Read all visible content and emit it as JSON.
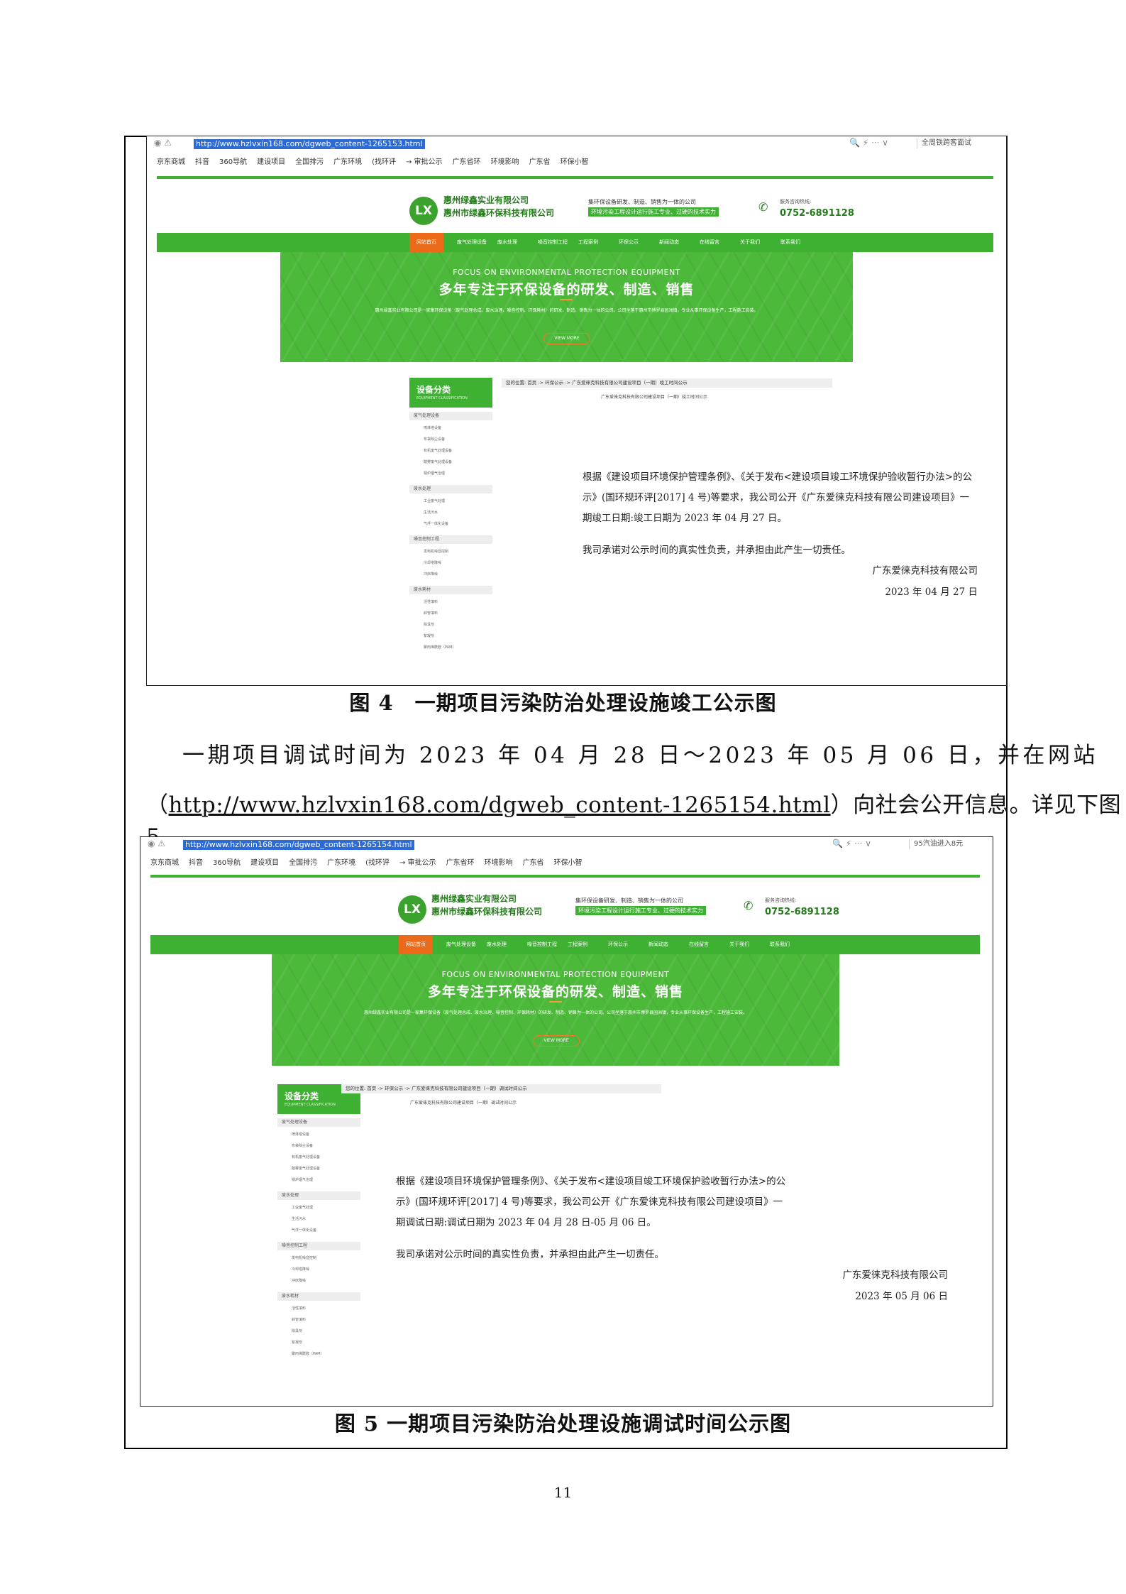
{
  "page_number": "11",
  "figure4": {
    "caption": "图 4　一期项目污染防治处理设施竣工公示图",
    "screenshot": {
      "url": "http://www.hzlvxin168.com/dgweb_content-1265153.html",
      "search_text": "全周铁跨客面试",
      "bookmarks": [
        "京东商城",
        "抖音",
        "360导航",
        "建设项目",
        "全国排污",
        "广东环境",
        "(找环评",
        "→ 审批公示",
        "广东省环",
        "环境影响",
        "广东省",
        "环保小智"
      ],
      "company_name_1": "惠州绿鑫实业有限公司",
      "company_name_2": "惠州市绿鑫环保科技有限公司",
      "slogan_1": "集环保设备研发、制造、销售为一体的公司",
      "slogan_2": "环境污染工程设计运行施工专业、过硬的技术实力",
      "phone_label": "服务咨询热线:",
      "phone": "0752-6891128",
      "logo": "LX",
      "nav": [
        "网站首页",
        "废气处理设备",
        "废水处理",
        "噪音控制工程",
        "工程案例",
        "环保公示",
        "新闻动态",
        "在线留言",
        "关于我们",
        "联系我们"
      ],
      "banner_en": "FOCUS ON ENVIRONMENTAL PROTECTION EQUIPMENT",
      "banner_zh": "多年专注于环保设备的研发、制造、销售",
      "banner_desc": "惠州绿鑫实业有限公司是一家集环保设备（废气处理总成、废水治理、噪音控制、环保耗材）的研发、制造、销售为一体的公司。公司坐落于惠州市博罗县园洲镇，专业从事环保设备生产，工程施工安装。",
      "view_more": "VIEW MORE",
      "sidebar_title": "设备分类",
      "sidebar_sub": "EQUIPMENT CLASSIFICATION",
      "sidebar": [
        {
          "cat": "废气处理设备",
          "items": [
            "喷淋塔设备",
            "布袋除尘设备",
            "有机废气处理设备",
            "酸雾废气处理设备",
            "锅炉烟气治理"
          ]
        },
        {
          "cat": "废水处理",
          "items": [
            "工业废气处理",
            "生活污水",
            "气浮一体化设备"
          ]
        },
        {
          "cat": "噪音控制工程",
          "items": [
            "发电机噪音控制",
            "冷却塔降噪",
            "冲床降噪"
          ]
        },
        {
          "cat": "废水耗材",
          "items": [
            "活性填料",
            "斜管填料",
            "除臭剂",
            "絮凝剂",
            "聚丙烯酰胺（PAM）"
          ]
        }
      ],
      "breadcrumb": "您的位置: 首页 -> 环保公示 -> 广东爱徕克科技有限公司建设项目（一期）竣工时间公示",
      "subtitle": "广东爱徕克科技有限公司建设项目（一期）竣工时间公示",
      "notice": "根据《建设项目环境保护管理条例》、《关于发布<建设项目竣工环境保护验收暂行办法>的公示》(国环规环评[2017] 4 号)等要求，我公司公开《广东爱徕克科技有限公司建设项目》一期竣工日期:竣工日期为 2023 年 04 月 27 日。",
      "pledge": "我司承诺对公示时间的真实性负责，并承担由此产生一切责任。",
      "sign_company": "广东爱徕克科技有限公司",
      "sign_date": "2023 年 04 月 27 日"
    }
  },
  "paragraph1": "一期项目调试时间为 2023 年 04 月 28 日～2023 年 05 月 06 日，并在网站",
  "paragraph2_pre": "（",
  "paragraph2_link": "http://www.hzlvxin168.com/dgweb_content-1265154.html",
  "paragraph2_post": "）向社会公开信息。详见下图 5。",
  "figure5": {
    "caption": "图 5 一期项目污染防治处理设施调试时间公示图",
    "screenshot": {
      "url": "http://www.hzlvxin168.com/dgweb_content-1265154.html",
      "search_text": "95汽油进入8元",
      "bookmarks": [
        "京东商城",
        "抖音",
        "360导航",
        "建设项目",
        "全国排污",
        "广东环境",
        "(找环评",
        "→ 审批公示",
        "广东省环",
        "环境影响",
        "广东省",
        "环保小智"
      ],
      "breadcrumb": "您的位置: 首页 -> 环保公示 -> 广东爱徕克科技有限公司建设项目（一期）调试时间公示",
      "subtitle": "广东爱徕克科技有限公司建设项目（一期）调试时间公示",
      "notice": "根据《建设项目环境保护管理条例》、《关于发布<建设项目竣工环境保护验收暂行办法>的公示》(国环规环评[2017] 4 号)等要求，我公司公开《广东爱徕克科技有限公司建设项目》一期调试日期:调试日期为 2023 年 04 月 28 日-05 月 06 日。",
      "pledge": "我司承诺对公示时间的真实性负责，并承担由此产生一切责任。",
      "sign_company": "广东爱徕克科技有限公司",
      "sign_date": "2023 年 05 月 06 日"
    }
  }
}
